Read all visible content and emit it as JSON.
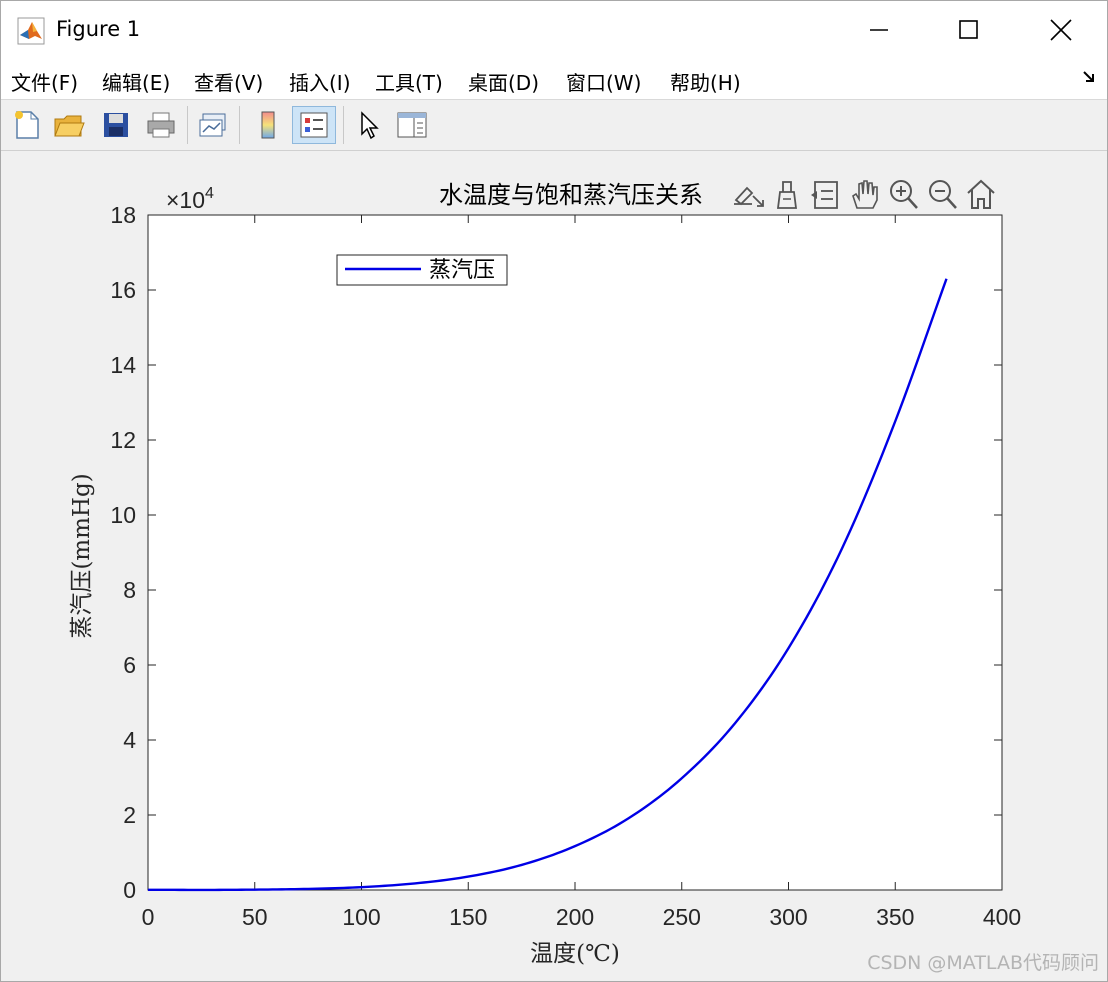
{
  "window": {
    "title": "Figure 1"
  },
  "menu": [
    "文件(F)",
    "编辑(E)",
    "查看(V)",
    "插入(I)",
    "工具(T)",
    "桌面(D)",
    "窗口(W)",
    "帮助(H)"
  ],
  "menu_extra_icon": "dock-arrow-icon",
  "toolbar": [
    "new-figure",
    "open-file",
    "save",
    "print",
    "link-plot",
    "colorbar",
    "legend",
    "edit-plot",
    "property-inspector"
  ],
  "axes_toolbar": [
    "export",
    "brush",
    "data-tips",
    "pan",
    "zoom-in",
    "zoom-out",
    "restore-view"
  ],
  "watermark": "CSDN @MATLAB代码顾问",
  "chart_data": {
    "type": "line",
    "title": "水温度与饱和蒸汽压关系",
    "xlabel": "温度(℃)",
    "ylabel": "蒸汽压(mmHg)",
    "y_exponent_label": "×10",
    "y_exponent_power": "4",
    "xlim": [
      0,
      400
    ],
    "ylim": [
      0,
      18
    ],
    "y_scale_factor": 10000,
    "xticks": [
      "0",
      "50",
      "100",
      "150",
      "200",
      "250",
      "300",
      "350",
      "400"
    ],
    "yticks": [
      "0",
      "2",
      "4",
      "6",
      "8",
      "10",
      "12",
      "14",
      "16",
      "18"
    ],
    "grid": false,
    "legend_position": "top-left",
    "line_color": "#0000e6",
    "series": [
      {
        "name": "蒸汽压",
        "x": [
          0,
          25,
          50,
          75,
          100,
          125,
          150,
          175,
          200,
          225,
          250,
          275,
          300,
          325,
          350,
          374
        ],
        "y": [
          0.006,
          0.0024,
          0.0093,
          0.029,
          0.076,
          0.176,
          0.357,
          0.669,
          1.17,
          1.91,
          2.98,
          4.45,
          6.45,
          9.1,
          12.5,
          16.3
        ]
      }
    ]
  }
}
